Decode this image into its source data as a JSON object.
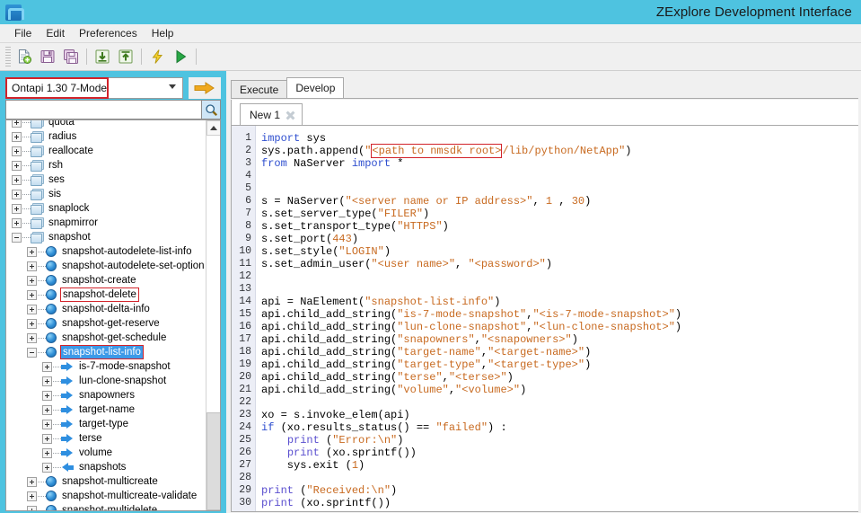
{
  "window": {
    "title": "ZExplore Development Interface",
    "app_icon": "netapp-logo-icon",
    "titlebar_color": "#4ec3e0"
  },
  "menubar": {
    "items": [
      {
        "label": "File"
      },
      {
        "label": "Edit"
      },
      {
        "label": "Preferences"
      },
      {
        "label": "Help"
      }
    ]
  },
  "toolbar": {
    "buttons": [
      {
        "name": "new-file-icon",
        "title": "New"
      },
      {
        "name": "save-icon",
        "title": "Save"
      },
      {
        "name": "save-all-icon",
        "title": "Save All"
      },
      {
        "name": "import-icon",
        "title": "Import"
      },
      {
        "name": "export-icon",
        "title": "Export"
      },
      {
        "name": "lightning-icon",
        "title": "Connect"
      },
      {
        "name": "run-icon",
        "title": "Run"
      }
    ]
  },
  "sidebar": {
    "version_combo": {
      "value": "Ontapi 1.30 7-Mode",
      "highlighted": true,
      "highlight_color": "#d2232a"
    },
    "go_button": {
      "name": "go-arrow-icon"
    },
    "search": {
      "value": "",
      "placeholder": ""
    },
    "search_button": {
      "name": "search-icon"
    },
    "tree": [
      {
        "label": "quota",
        "indent": 0,
        "icon": "folder",
        "expander": "plus",
        "state": "normal"
      },
      {
        "label": "radius",
        "indent": 0,
        "icon": "folder",
        "expander": "plus",
        "state": "normal"
      },
      {
        "label": "reallocate",
        "indent": 0,
        "icon": "folder",
        "expander": "plus",
        "state": "normal"
      },
      {
        "label": "rsh",
        "indent": 0,
        "icon": "folder",
        "expander": "plus",
        "state": "normal"
      },
      {
        "label": "ses",
        "indent": 0,
        "icon": "folder",
        "expander": "plus",
        "state": "normal"
      },
      {
        "label": "sis",
        "indent": 0,
        "icon": "folder",
        "expander": "plus",
        "state": "normal"
      },
      {
        "label": "snaplock",
        "indent": 0,
        "icon": "folder",
        "expander": "plus",
        "state": "normal"
      },
      {
        "label": "snapmirror",
        "indent": 0,
        "icon": "folder",
        "expander": "plus",
        "state": "normal"
      },
      {
        "label": "snapshot",
        "indent": 0,
        "icon": "folder",
        "expander": "minus",
        "state": "normal"
      },
      {
        "label": "snapshot-autodelete-list-info",
        "indent": 1,
        "icon": "globe",
        "expander": "plus",
        "state": "normal"
      },
      {
        "label": "snapshot-autodelete-set-option",
        "indent": 1,
        "icon": "globe",
        "expander": "plus",
        "state": "normal"
      },
      {
        "label": "snapshot-create",
        "indent": 1,
        "icon": "globe",
        "expander": "plus",
        "state": "normal"
      },
      {
        "label": "snapshot-delete",
        "indent": 1,
        "icon": "globe",
        "expander": "plus",
        "state": "boxed"
      },
      {
        "label": "snapshot-delta-info",
        "indent": 1,
        "icon": "globe",
        "expander": "plus",
        "state": "normal"
      },
      {
        "label": "snapshot-get-reserve",
        "indent": 1,
        "icon": "globe",
        "expander": "plus",
        "state": "normal"
      },
      {
        "label": "snapshot-get-schedule",
        "indent": 1,
        "icon": "globe",
        "expander": "plus",
        "state": "normal"
      },
      {
        "label": "snapshot-list-info",
        "indent": 1,
        "icon": "globe",
        "expander": "minus",
        "state": "selected"
      },
      {
        "label": "is-7-mode-snapshot",
        "indent": 2,
        "icon": "arrow-r",
        "expander": "plus",
        "state": "normal"
      },
      {
        "label": "lun-clone-snapshot",
        "indent": 2,
        "icon": "arrow-r",
        "expander": "plus",
        "state": "normal"
      },
      {
        "label": "snapowners",
        "indent": 2,
        "icon": "arrow-r",
        "expander": "plus",
        "state": "normal"
      },
      {
        "label": "target-name",
        "indent": 2,
        "icon": "arrow-r",
        "expander": "plus",
        "state": "normal"
      },
      {
        "label": "target-type",
        "indent": 2,
        "icon": "arrow-r",
        "expander": "plus",
        "state": "normal"
      },
      {
        "label": "terse",
        "indent": 2,
        "icon": "arrow-r",
        "expander": "plus",
        "state": "normal"
      },
      {
        "label": "volume",
        "indent": 2,
        "icon": "arrow-r",
        "expander": "plus",
        "state": "normal"
      },
      {
        "label": "snapshots",
        "indent": 2,
        "icon": "arrow-l",
        "expander": "plus",
        "state": "normal"
      },
      {
        "label": "snapshot-multicreate",
        "indent": 1,
        "icon": "globe",
        "expander": "plus",
        "state": "normal"
      },
      {
        "label": "snapshot-multicreate-validate",
        "indent": 1,
        "icon": "globe",
        "expander": "plus",
        "state": "normal"
      },
      {
        "label": "snapshot-multidelete",
        "indent": 1,
        "icon": "globe",
        "expander": "plus",
        "state": "normal"
      }
    ]
  },
  "main": {
    "tabs": [
      {
        "label": "Execute",
        "active": false
      },
      {
        "label": "Develop",
        "active": true
      }
    ],
    "doc_tabs": [
      {
        "label": "New 1",
        "active": true,
        "close_icon": "close-icon"
      }
    ],
    "editor": {
      "line_numbers": [
        1,
        2,
        3,
        4,
        5,
        6,
        7,
        8,
        9,
        10,
        11,
        12,
        13,
        14,
        15,
        16,
        17,
        18,
        19,
        20,
        21,
        22,
        23,
        24,
        25,
        26,
        27,
        28,
        29,
        30
      ],
      "lines": [
        [
          {
            "t": "import ",
            "c": "kw"
          },
          {
            "t": "sys",
            "c": ""
          }
        ],
        [
          {
            "t": "sys.path.append(",
            "c": ""
          },
          {
            "t": "\"",
            "c": "str"
          },
          {
            "t": "<path to nmsdk root>",
            "c": "str mark"
          },
          {
            "t": "/lib/python/NetApp\"",
            "c": "str"
          },
          {
            "t": ")",
            "c": ""
          }
        ],
        [
          {
            "t": "from ",
            "c": "kw"
          },
          {
            "t": "NaServer ",
            "c": ""
          },
          {
            "t": "import ",
            "c": "kw"
          },
          {
            "t": "*",
            "c": ""
          }
        ],
        [
          {
            "t": "",
            "c": ""
          }
        ],
        [
          {
            "t": "",
            "c": ""
          }
        ],
        [
          {
            "t": "s = NaServer(",
            "c": ""
          },
          {
            "t": "\"<server name or IP address>\"",
            "c": "str"
          },
          {
            "t": ", ",
            "c": ""
          },
          {
            "t": "1",
            "c": "num"
          },
          {
            "t": " , ",
            "c": ""
          },
          {
            "t": "30",
            "c": "num"
          },
          {
            "t": ")",
            "c": ""
          }
        ],
        [
          {
            "t": "s.set_server_type(",
            "c": ""
          },
          {
            "t": "\"FILER\"",
            "c": "str"
          },
          {
            "t": ")",
            "c": ""
          }
        ],
        [
          {
            "t": "s.set_transport_type(",
            "c": ""
          },
          {
            "t": "\"HTTPS\"",
            "c": "str"
          },
          {
            "t": ")",
            "c": ""
          }
        ],
        [
          {
            "t": "s.set_port(",
            "c": ""
          },
          {
            "t": "443",
            "c": "num"
          },
          {
            "t": ")",
            "c": ""
          }
        ],
        [
          {
            "t": "s.set_style(",
            "c": ""
          },
          {
            "t": "\"LOGIN\"",
            "c": "str"
          },
          {
            "t": ")",
            "c": ""
          }
        ],
        [
          {
            "t": "s.set_admin_user(",
            "c": ""
          },
          {
            "t": "\"<user name>\"",
            "c": "str"
          },
          {
            "t": ", ",
            "c": ""
          },
          {
            "t": "\"<password>\"",
            "c": "str"
          },
          {
            "t": ")",
            "c": ""
          }
        ],
        [
          {
            "t": "",
            "c": ""
          }
        ],
        [
          {
            "t": "",
            "c": ""
          }
        ],
        [
          {
            "t": "api = NaElement(",
            "c": ""
          },
          {
            "t": "\"snapshot-list-info\"",
            "c": "str"
          },
          {
            "t": ")",
            "c": ""
          }
        ],
        [
          {
            "t": "api.child_add_string(",
            "c": ""
          },
          {
            "t": "\"is-7-mode-snapshot\"",
            "c": "str"
          },
          {
            "t": ",",
            "c": ""
          },
          {
            "t": "\"<is-7-mode-snapshot>\"",
            "c": "str"
          },
          {
            "t": ")",
            "c": ""
          }
        ],
        [
          {
            "t": "api.child_add_string(",
            "c": ""
          },
          {
            "t": "\"lun-clone-snapshot\"",
            "c": "str"
          },
          {
            "t": ",",
            "c": ""
          },
          {
            "t": "\"<lun-clone-snapshot>\"",
            "c": "str"
          },
          {
            "t": ")",
            "c": ""
          }
        ],
        [
          {
            "t": "api.child_add_string(",
            "c": ""
          },
          {
            "t": "\"snapowners\"",
            "c": "str"
          },
          {
            "t": ",",
            "c": ""
          },
          {
            "t": "\"<snapowners>\"",
            "c": "str"
          },
          {
            "t": ")",
            "c": ""
          }
        ],
        [
          {
            "t": "api.child_add_string(",
            "c": ""
          },
          {
            "t": "\"target-name\"",
            "c": "str"
          },
          {
            "t": ",",
            "c": ""
          },
          {
            "t": "\"<target-name>\"",
            "c": "str"
          },
          {
            "t": ")",
            "c": ""
          }
        ],
        [
          {
            "t": "api.child_add_string(",
            "c": ""
          },
          {
            "t": "\"target-type\"",
            "c": "str"
          },
          {
            "t": ",",
            "c": ""
          },
          {
            "t": "\"<target-type>\"",
            "c": "str"
          },
          {
            "t": ")",
            "c": ""
          }
        ],
        [
          {
            "t": "api.child_add_string(",
            "c": ""
          },
          {
            "t": "\"terse\"",
            "c": "str"
          },
          {
            "t": ",",
            "c": ""
          },
          {
            "t": "\"<terse>\"",
            "c": "str"
          },
          {
            "t": ")",
            "c": ""
          }
        ],
        [
          {
            "t": "api.child_add_string(",
            "c": ""
          },
          {
            "t": "\"volume\"",
            "c": "str"
          },
          {
            "t": ",",
            "c": ""
          },
          {
            "t": "\"<volume>\"",
            "c": "str"
          },
          {
            "t": ")",
            "c": ""
          }
        ],
        [
          {
            "t": "",
            "c": ""
          }
        ],
        [
          {
            "t": "xo = s.invoke_elem(api)",
            "c": ""
          }
        ],
        [
          {
            "t": "if ",
            "c": "kw"
          },
          {
            "t": "(xo.results_status() == ",
            "c": ""
          },
          {
            "t": "\"failed\"",
            "c": "str"
          },
          {
            "t": ") :",
            "c": ""
          }
        ],
        [
          {
            "t": "    ",
            "c": ""
          },
          {
            "t": "print ",
            "c": "fn"
          },
          {
            "t": "(",
            "c": ""
          },
          {
            "t": "\"Error:\\n\"",
            "c": "str"
          },
          {
            "t": ")",
            "c": ""
          }
        ],
        [
          {
            "t": "    ",
            "c": ""
          },
          {
            "t": "print ",
            "c": "fn"
          },
          {
            "t": "(xo.sprintf())",
            "c": ""
          }
        ],
        [
          {
            "t": "    sys.exit (",
            "c": ""
          },
          {
            "t": "1",
            "c": "num"
          },
          {
            "t": ")",
            "c": ""
          }
        ],
        [
          {
            "t": "",
            "c": ""
          }
        ],
        [
          {
            "t": "print ",
            "c": "fn"
          },
          {
            "t": "(",
            "c": ""
          },
          {
            "t": "\"Received:\\n\"",
            "c": "str"
          },
          {
            "t": ")",
            "c": ""
          }
        ],
        [
          {
            "t": "print ",
            "c": "fn"
          },
          {
            "t": "(xo.sprintf())",
            "c": ""
          }
        ]
      ]
    }
  }
}
